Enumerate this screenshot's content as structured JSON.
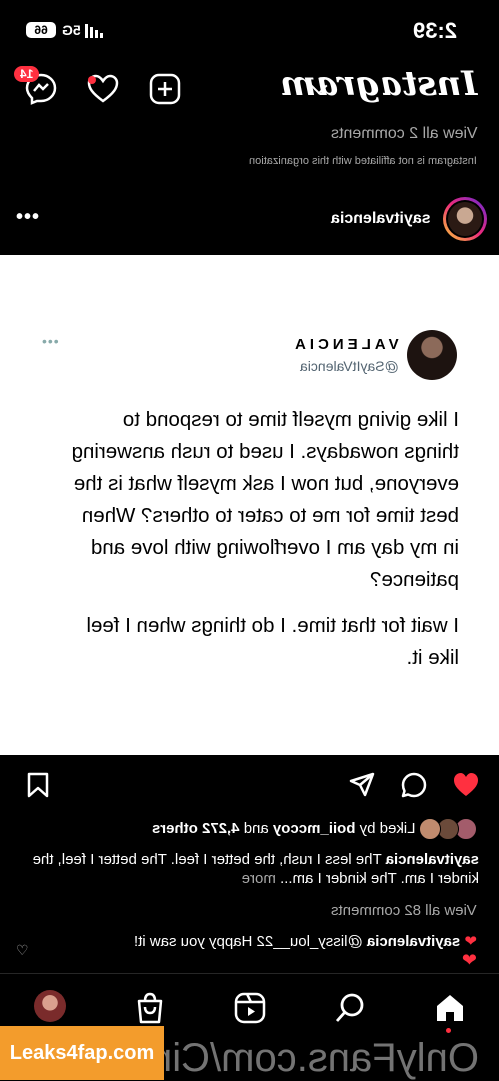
{
  "status_bar": {
    "time": "2:39",
    "battery": "66",
    "signal": "5G"
  },
  "header": {
    "logo": "Instagram",
    "notifications_badge": "14"
  },
  "previous_post": {
    "view_comments": "View all 2 comments",
    "affiliate_note": "Instagram is not affiliated with this organization"
  },
  "post": {
    "username": "sayitvalencia",
    "tweet": {
      "name": "VALENCIA",
      "handle": "@SayItValencia",
      "paragraph1": "I like giving myself time to respond to things nowadays. I used to rush answering everyone, but now I ask myself what is the best time for me to cater to others? When in my day am I overflowing with love and patience?",
      "paragraph2": "I wait for that time. I do things when I feel like it."
    },
    "liked_by_prefix": "Liked by",
    "liked_by_user": "boii_mccoy",
    "liked_by_and": "and",
    "liked_by_others": "4,272 others",
    "caption_user": "sayitvalencia",
    "caption_text": "The less I rush, the better I feel. The better I feel, the kinder I am. The kinder I am...",
    "caption_more": "more",
    "view_all_comments": "View all 82 comments",
    "reply_user": "sayitvalencia",
    "reply_text": "@lissy_lou__22 Happy you saw it!"
  },
  "watermark": {
    "text": "OnlyFans.com/Cin",
    "badge": "Leaks4fap.com"
  },
  "colors": {
    "accent_red": "#ff3040",
    "muted_text": "#a8a8a8",
    "watermark_orange": "#f39c2c"
  }
}
